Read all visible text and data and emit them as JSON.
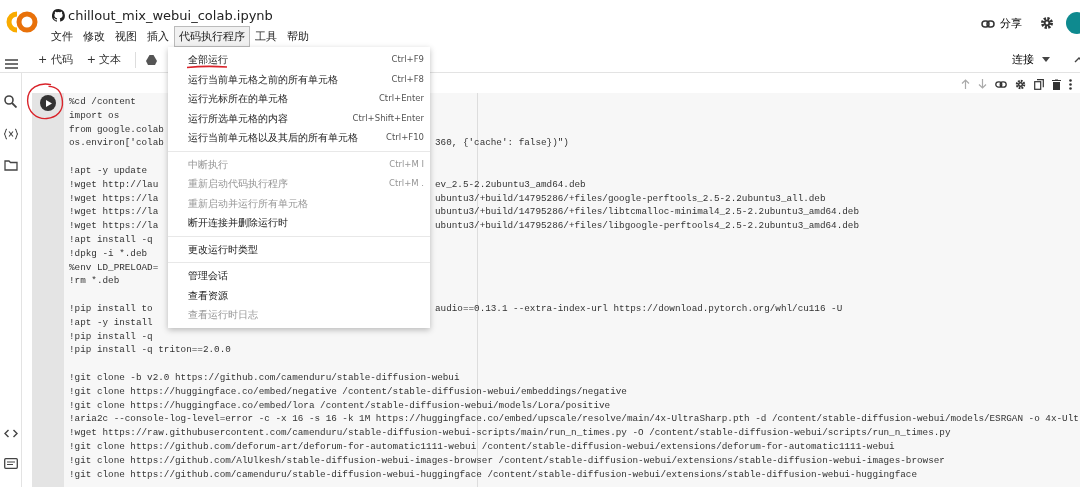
{
  "notebook": {
    "title": "chillout_mix_webui_colab.ipynb"
  },
  "menubar": [
    {
      "label": "文件",
      "selected": false
    },
    {
      "label": "修改",
      "selected": false
    },
    {
      "label": "视图",
      "selected": false
    },
    {
      "label": "插入",
      "selected": false
    },
    {
      "label": "代码执行程序",
      "selected": true
    },
    {
      "label": "工具",
      "selected": false
    },
    {
      "label": "帮助",
      "selected": false
    }
  ],
  "header_actions": {
    "share": "分享"
  },
  "toolbar": {
    "add_code": "+ 代码",
    "add_text": "+ 文本",
    "connect": "连接"
  },
  "dropdown": {
    "sections": [
      [
        {
          "label": "全部运行",
          "shortcut": "Ctrl+F9",
          "disabled": false
        },
        {
          "label": "运行当前单元格之前的所有单元格",
          "shortcut": "Ctrl+F8",
          "disabled": false
        },
        {
          "label": "运行光标所在的单元格",
          "shortcut": "Ctrl+Enter",
          "disabled": false
        },
        {
          "label": "运行所选单元格的内容",
          "shortcut": "Ctrl+Shift+Enter",
          "disabled": false
        },
        {
          "label": "运行当前单元格以及其后的所有单元格",
          "shortcut": "Ctrl+F10",
          "disabled": false
        }
      ],
      [
        {
          "label": "中断执行",
          "shortcut": "Ctrl+M I",
          "disabled": true
        },
        {
          "label": "重新启动代码执行程序",
          "shortcut": "Ctrl+M .",
          "disabled": true
        },
        {
          "label": "重新启动并运行所有单元格",
          "disabled": true
        },
        {
          "label": "断开连接并删除运行时",
          "disabled": false
        }
      ],
      [
        {
          "label": "更改运行时类型",
          "disabled": false
        }
      ],
      [
        {
          "label": "管理会话",
          "disabled": false
        },
        {
          "label": "查看资源",
          "disabled": false
        },
        {
          "label": "查看运行时日志",
          "disabled": true
        }
      ]
    ]
  },
  "code_blocks": [
    [
      {
        "text": "%cd /content"
      },
      {
        "text": "import os"
      },
      {
        "text": "from google.colab"
      },
      {
        "text": "os.environ['colab",
        "right": "360, {'cache': false})\")"
      }
    ],
    [
      {
        "text": "!apt -y update"
      },
      {
        "text": "!wget http://lau",
        "right": "ev_2.5-2.2ubuntu3_amd64.deb"
      },
      {
        "text": "!wget https://la",
        "right": "ubuntu3/+build/14795286/+files/google-perftools_2.5-2.2ubuntu3_all.deb"
      },
      {
        "text": "!wget https://la",
        "right": "ubuntu3/+build/14795286/+files/libtcmalloc-minimal4_2.5-2.2ubuntu3_amd64.deb"
      },
      {
        "text": "!wget https://la",
        "right": "ubuntu3/+build/14795286/+files/libgoogle-perftools4_2.5-2.2ubuntu3_amd64.deb"
      },
      {
        "text": "!apt install -q"
      },
      {
        "text": "!dpkg -i *.deb"
      },
      {
        "text": "%env LD_PRELOAD="
      },
      {
        "text": "!rm *.deb"
      }
    ],
    [
      {
        "text": "!pip install to",
        "right": "audio==0.13.1 --extra-index-url https://download.pytorch.org/whl/cu116 -U"
      },
      {
        "text": "!apt -y install"
      },
      {
        "text": "!pip install -q"
      },
      {
        "text": "!pip install -q triton==2.0.0"
      }
    ],
    [
      {
        "text": "!git clone -b v2.0 https://github.com/camenduru/stable-diffusion-webui"
      },
      {
        "text": "!git clone https://huggingface.co/embed/negative /content/stable-diffusion-webui/embeddings/negative"
      },
      {
        "text": "!git clone https://huggingface.co/embed/lora /content/stable-diffusion-webui/models/Lora/positive"
      },
      {
        "text": "!aria2c --console-log-level=error -c -x 16 -s 16 -k 1M https://huggingface.co/embed/upscale/resolve/main/4x-UltraSharp.pth -d /content/stable-diffusion-webui/models/ESRGAN -o 4x-Ult"
      },
      {
        "text": "!wget https://raw.githubusercontent.com/camenduru/stable-diffusion-webui-scripts/main/run_n_times.py -O /content/stable-diffusion-webui/scripts/run_n_times.py"
      },
      {
        "text": "!git clone https://github.com/deforum-art/deforum-for-automatic1111-webui /content/stable-diffusion-webui/extensions/deforum-for-automatic1111-webui"
      },
      {
        "text": "!git clone https://github.com/AlUlkesh/stable-diffusion-webui-images-browser /content/stable-diffusion-webui/extensions/stable-diffusion-webui-images-browser"
      },
      {
        "text": "!git clone https://github.com/camenduru/stable-diffusion-webui-huggingface /content/stable-diffusion-webui/extensions/stable-diffusion-webui-huggingface"
      }
    ]
  ]
}
